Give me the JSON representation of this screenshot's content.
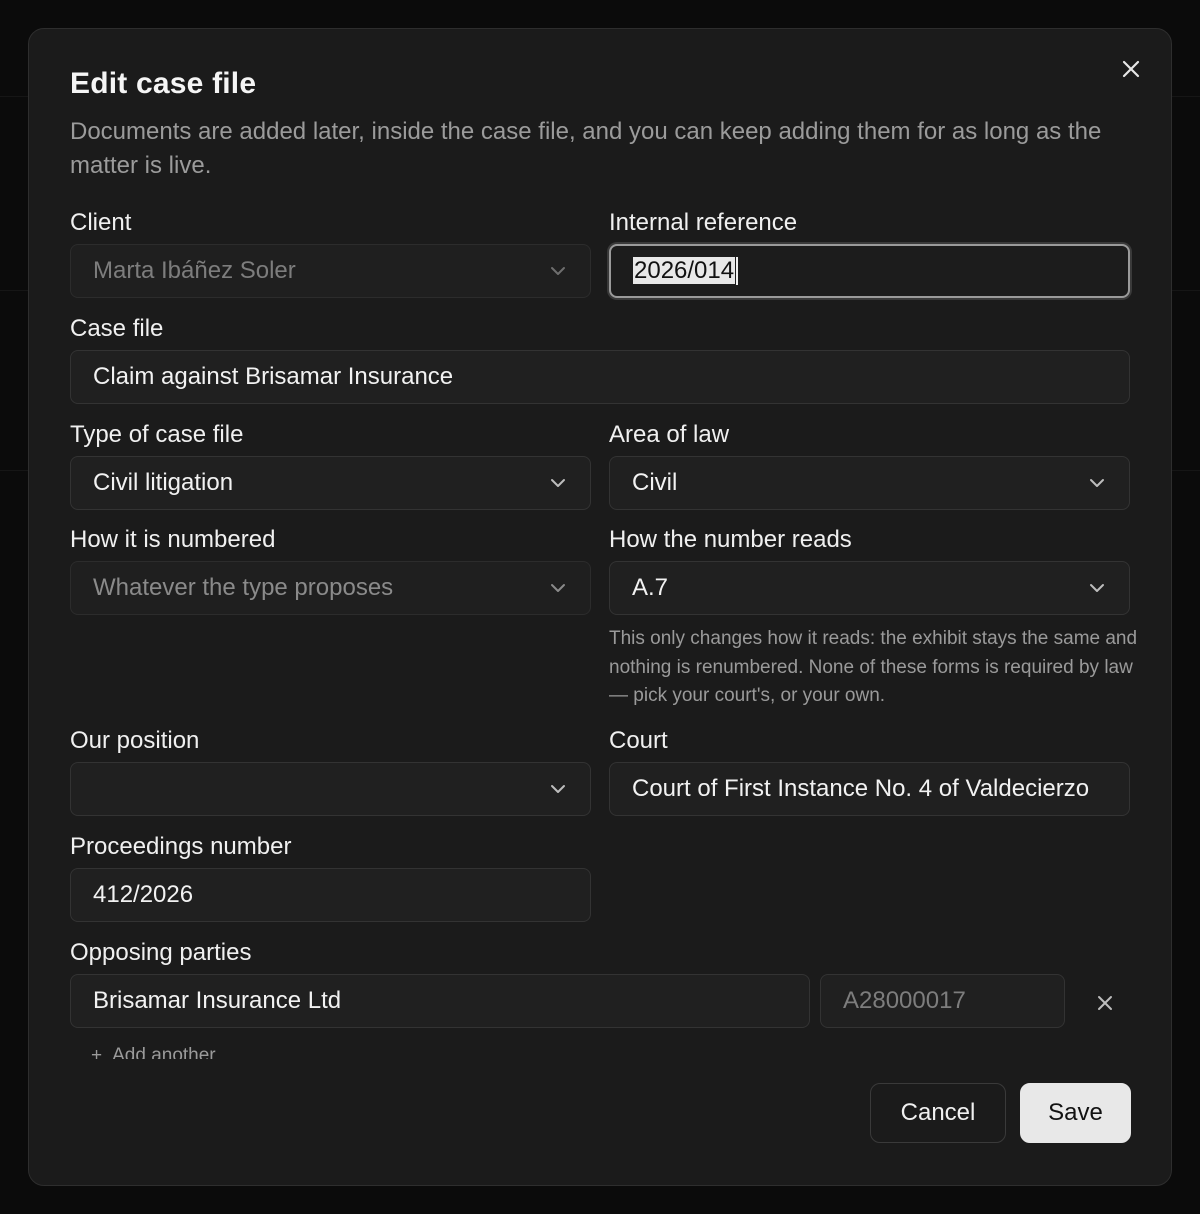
{
  "dialog": {
    "title": "Edit case file",
    "subtitle": "Documents are added later, inside the case file, and you can keep adding them for as long as the matter is live."
  },
  "form": {
    "client": {
      "label": "Client",
      "value": "Marta Ibáñez Soler",
      "disabled": true
    },
    "internal_reference": {
      "label": "Internal reference",
      "value": "2026/014",
      "focused": true
    },
    "case_file": {
      "label": "Case file",
      "value": "Claim against Brisamar Insurance"
    },
    "type_of_case_file": {
      "label": "Type of case file",
      "value": "Civil litigation"
    },
    "area_of_law": {
      "label": "Area of law",
      "value": "Civil"
    },
    "how_numbered": {
      "label": "How it is numbered",
      "value": "Whatever the type proposes"
    },
    "how_number_reads": {
      "label": "How the number reads",
      "value": "A.7",
      "help": "This only changes how it reads: the exhibit stays the same and nothing is renumbered. None of these forms is required by law — pick your court's, or your own."
    },
    "our_position": {
      "label": "Our position",
      "value": ""
    },
    "court": {
      "label": "Court",
      "value": "Court of First Instance No. 4 of Valdecierzo"
    },
    "proceedings_number": {
      "label": "Proceedings number",
      "value": "412/2026"
    },
    "opposing_parties": {
      "label": "Opposing parties",
      "items": [
        {
          "name": "Brisamar Insurance Ltd",
          "id_placeholder": "A28000017"
        }
      ],
      "add_label": "Add another"
    }
  },
  "actions": {
    "cancel_label": "Cancel",
    "save_label": "Save"
  },
  "icons": {
    "close": "close-icon",
    "chevron": "chevron-down-icon",
    "remove": "close-icon",
    "add": "plus-icon"
  },
  "colors": {
    "modal_bg": "#1b1b1b",
    "field_bg": "#202020",
    "muted_text": "#9b9b9b",
    "primary_button_bg": "#e8e8e8"
  }
}
